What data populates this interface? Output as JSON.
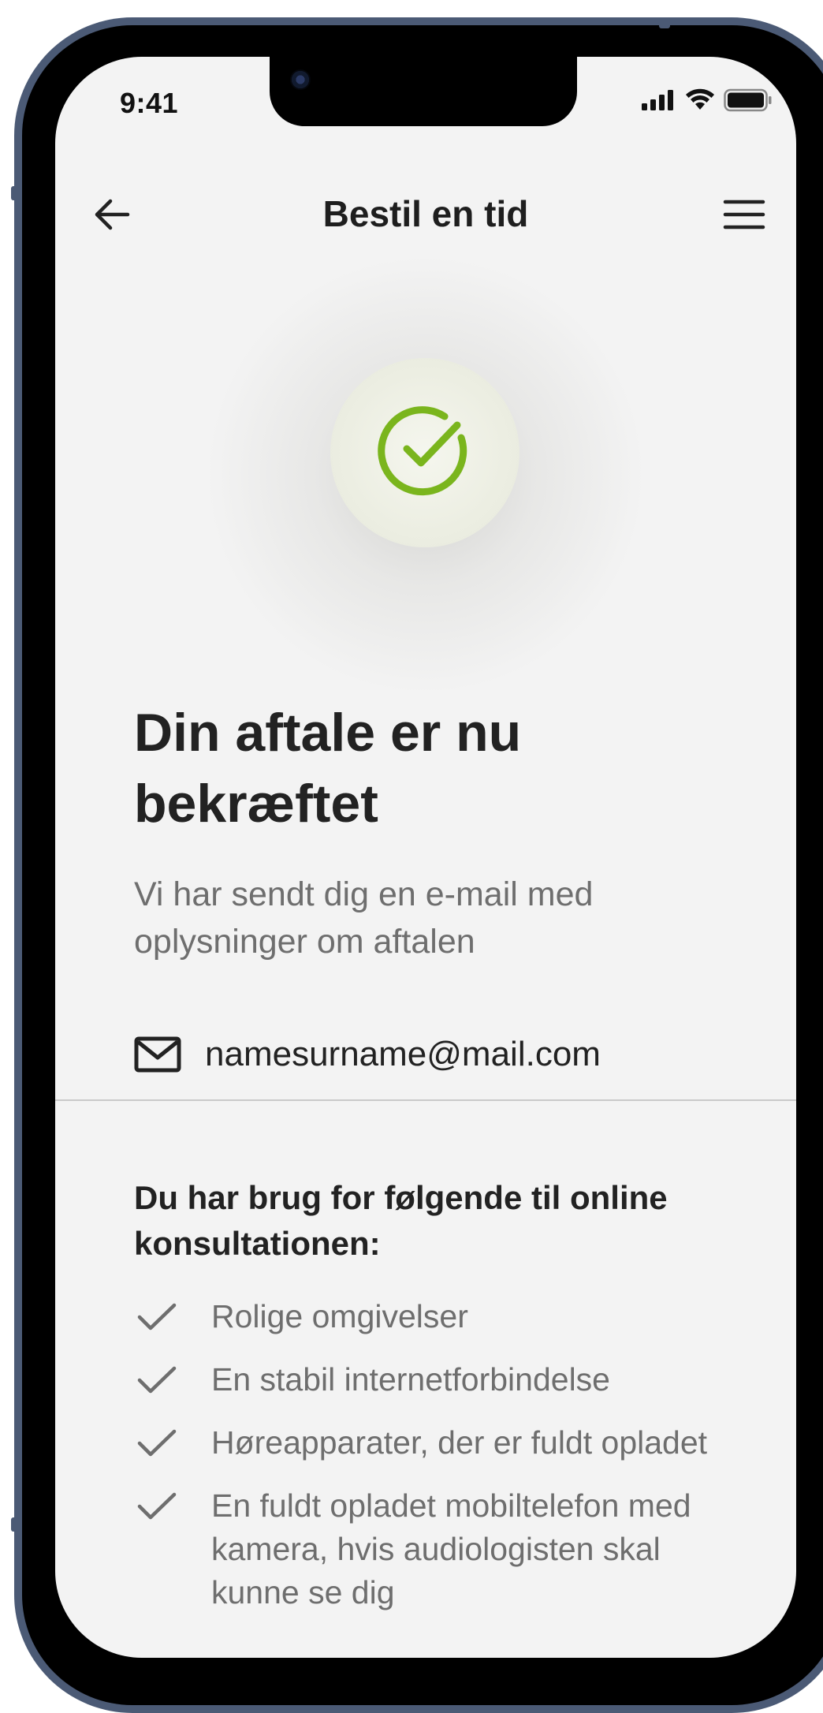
{
  "status_bar": {
    "time": "9:41"
  },
  "header": {
    "title": "Bestil en tid"
  },
  "confirmation": {
    "title": "Din aftale er nu bekræftet",
    "subtitle": "Vi har sendt dig en e-mail med oplysninger om aftalen",
    "email": "namesurname@mail.com"
  },
  "needs": {
    "heading": "Du har brug for følgende til online konsultationen:",
    "items": [
      "Rolige omgivelser",
      "En stabil internetforbindelse",
      "Høreapparater, der er fuldt opladet",
      "En fuldt opladet mobiltelefon med kamera, hvis audiologisten skal kunne se dig"
    ]
  },
  "icons": {
    "back": "arrow-left-icon",
    "menu": "hamburger-menu-icon",
    "success": "check-circle-icon",
    "email": "envelope-icon",
    "list_check": "checkmark-icon"
  },
  "colors": {
    "accent": "#7ab51d",
    "background": "#f3f3f3",
    "frame": "#4b5a75",
    "text_primary": "#222222",
    "text_secondary": "#6e6e6e"
  }
}
